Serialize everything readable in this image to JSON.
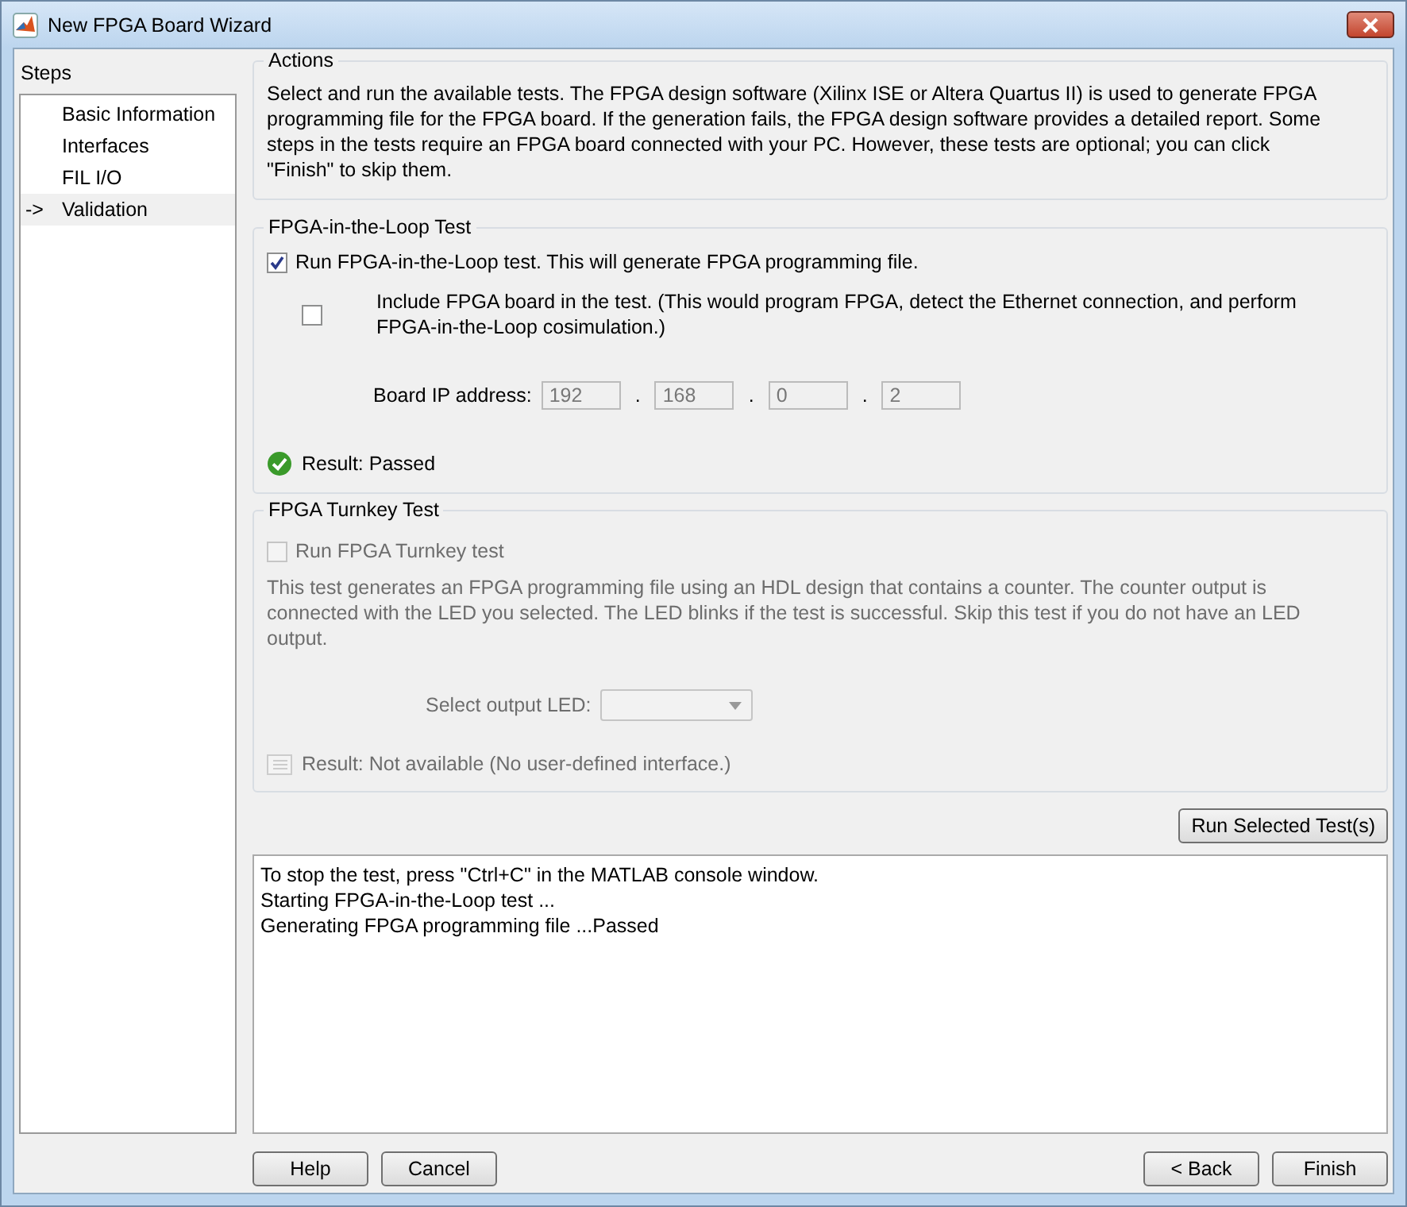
{
  "window": {
    "title": "New FPGA Board Wizard"
  },
  "steps": {
    "title": "Steps",
    "marker": "->",
    "items": [
      {
        "label": "Basic Information",
        "selected": false
      },
      {
        "label": "Interfaces",
        "selected": false
      },
      {
        "label": "FIL I/O",
        "selected": false
      },
      {
        "label": "Validation",
        "selected": true
      }
    ]
  },
  "actions": {
    "title": "Actions",
    "text": "Select and run the available tests. The FPGA design software (Xilinx ISE or Altera Quartus II) is used to generate FPGA programming file for the FPGA board. If the generation fails, the FPGA design software provides a detailed report. Some steps in the tests require an FPGA board connected with your PC. However, these tests are optional; you can click \"Finish\" to skip them."
  },
  "fil_test": {
    "title": "FPGA-in-the-Loop Test",
    "run": {
      "label": "Run FPGA-in-the-Loop test. This will generate FPGA programming file.",
      "checked": true
    },
    "include_board": {
      "label": "Include FPGA board in the test. (This would program FPGA, detect the Ethernet connection, and perform FPGA-in-the-Loop cosimulation.)",
      "checked": false
    },
    "ip_label": "Board IP address:",
    "ip_separator": ".",
    "ip": [
      "192",
      "168",
      "0",
      "2"
    ],
    "result": {
      "passed": true,
      "text": "Result: Passed"
    }
  },
  "turnkey_test": {
    "title": "FPGA Turnkey Test",
    "disabled": true,
    "run": {
      "label": "Run FPGA Turnkey test",
      "checked": false
    },
    "description": "This test generates an FPGA programming file using an HDL design that contains a counter. The counter output is connected with the LED you selected. The LED blinks if the test is successful. Skip this test if you do not have an LED output.",
    "led_label": "Select output LED:",
    "result": {
      "passed": false,
      "text": "Result: Not available (No user-defined interface.)"
    }
  },
  "run_button": "Run Selected Test(s)",
  "log": [
    "To stop the test, press \"Ctrl+C\" in the MATLAB console window.",
    "Starting FPGA-in-the-Loop test ...",
    "Generating FPGA programming file ...Passed"
  ],
  "buttons_left": [
    "Help",
    "Cancel"
  ],
  "buttons_right": [
    "< Back",
    "Finish"
  ]
}
